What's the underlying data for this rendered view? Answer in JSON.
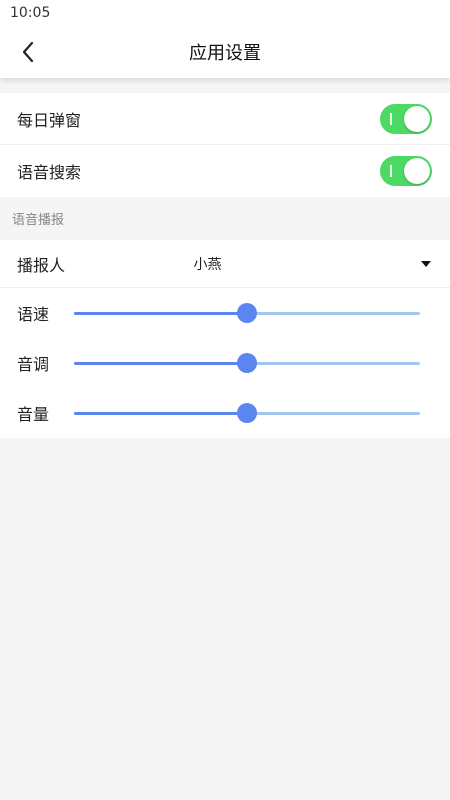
{
  "status_bar": {
    "time": "10:05"
  },
  "app_bar": {
    "title": "应用设置",
    "back_icon": "chevron-left-icon"
  },
  "toggles": [
    {
      "label": "每日弹窗",
      "on": true
    },
    {
      "label": "语音搜索",
      "on": true
    }
  ],
  "voice_section": {
    "header": "语音播报",
    "speaker": {
      "label": "播报人",
      "value": "小燕",
      "icon": "caret-down-icon"
    },
    "sliders": [
      {
        "label": "语速",
        "value": 0.5
      },
      {
        "label": "音调",
        "value": 0.5
      },
      {
        "label": "音量",
        "value": 0.5
      }
    ]
  },
  "colors": {
    "toggle_on": "#4cd964",
    "slider_active": "#5b86f0",
    "slider_track": "#a5c6ec",
    "background": "#f5f5f5"
  }
}
